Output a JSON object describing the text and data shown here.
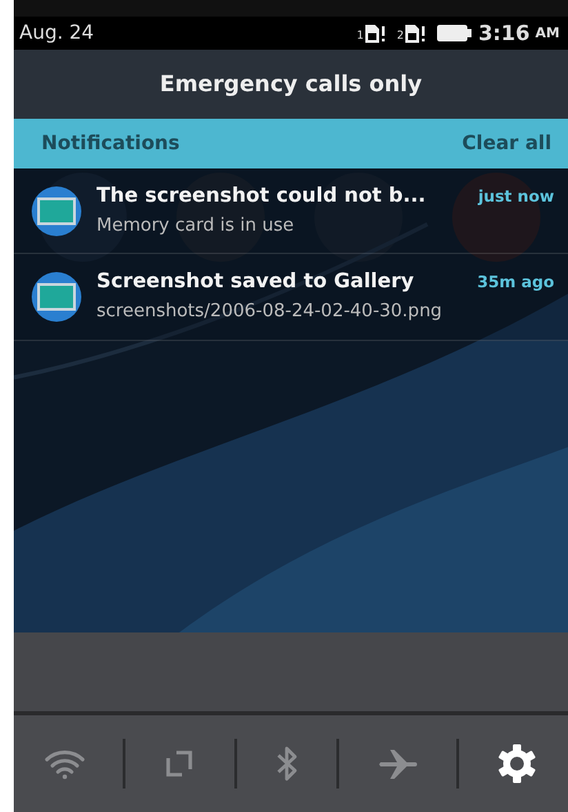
{
  "status_bar": {
    "date": "Aug. 24",
    "sims": [
      {
        "label": "1"
      },
      {
        "label": "2"
      }
    ],
    "time": "3:16",
    "meridiem": "AM"
  },
  "header": {
    "title": "Emergency calls only"
  },
  "notifications_bar": {
    "title": "Notifications",
    "action": "Clear all"
  },
  "notifications": [
    {
      "title": "The screenshot could not b...",
      "body": "Memory card is in use",
      "time": "just now"
    },
    {
      "title": "Screenshot saved to Gallery",
      "body": "screenshots/2006-08-24-02-40-30.png",
      "time": "35m ago"
    }
  ],
  "quick_settings": [
    {
      "kind": "wifi",
      "on": false
    },
    {
      "kind": "data",
      "on": false
    },
    {
      "kind": "bluetooth",
      "on": false
    },
    {
      "kind": "airplane",
      "on": false
    },
    {
      "kind": "settings"
    }
  ]
}
